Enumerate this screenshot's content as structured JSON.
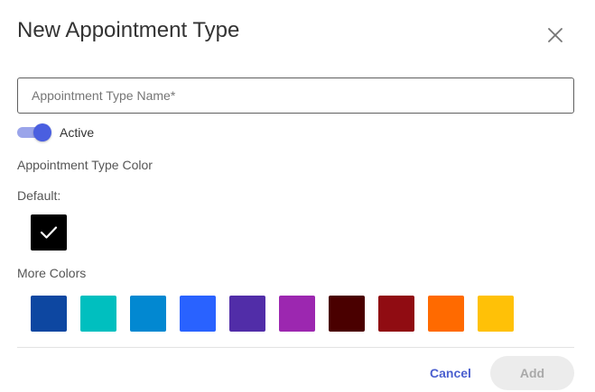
{
  "dialog": {
    "title": "New Appointment Type",
    "close_icon": "close-icon"
  },
  "name_field": {
    "value": "",
    "placeholder": "Appointment Type Name*"
  },
  "active_toggle": {
    "label": "Active",
    "checked": true
  },
  "color_section": {
    "heading": "Appointment Type Color",
    "default_label": "Default:",
    "default_color": "#000000",
    "default_selected": true,
    "more_label": "More Colors",
    "more_colors": [
      "#0d47a1",
      "#00bfbf",
      "#0288d1",
      "#2962ff",
      "#512da8",
      "#9c27b0",
      "#4a0000",
      "#900c12",
      "#ff6a00",
      "#ffc107"
    ]
  },
  "footer": {
    "cancel_label": "Cancel",
    "add_label": "Add"
  },
  "colors": {
    "accent": "#4a5fe0",
    "cancel_text": "#4a5fcf",
    "add_disabled_bg": "#ececec"
  }
}
